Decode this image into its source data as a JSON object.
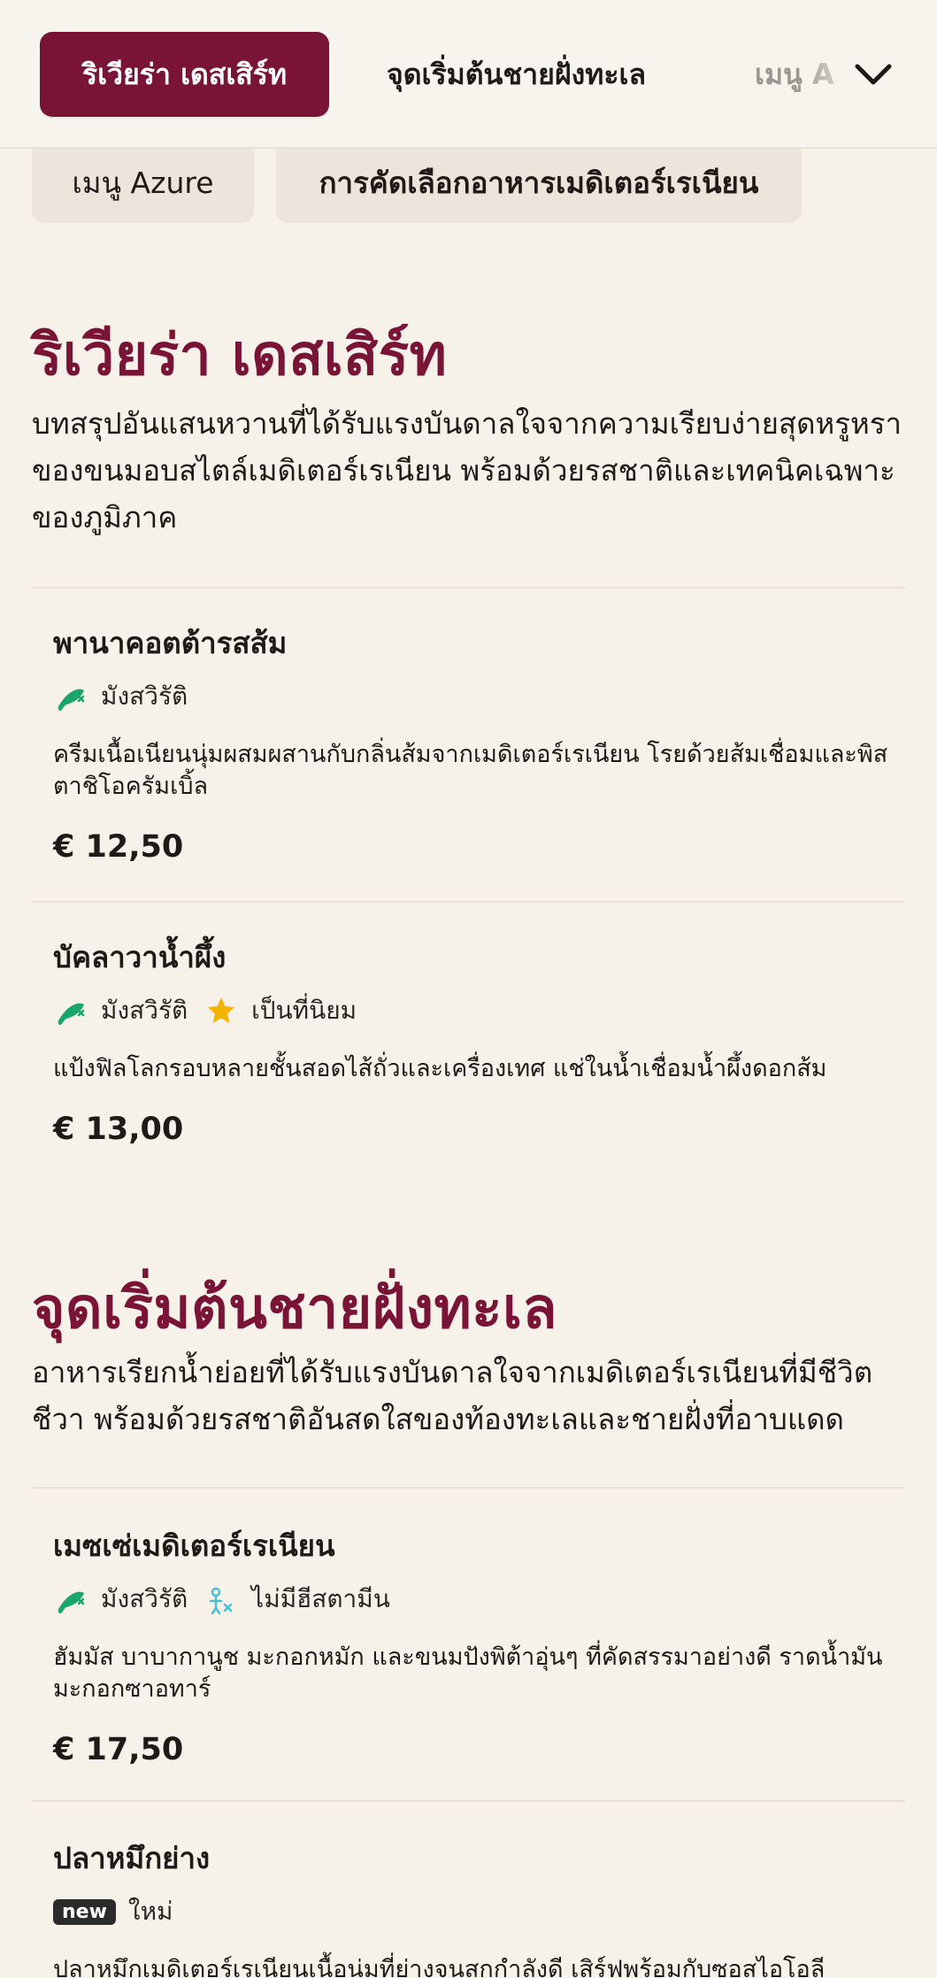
{
  "nav": {
    "tabs": [
      {
        "label": "ริเวียร่า เดสเสิร์ท",
        "active": true
      },
      {
        "label": "จุดเริ่มต้นชายฝั่งทะเล",
        "active": false
      },
      {
        "label": "เมนู Azure",
        "active": false
      }
    ],
    "more_icon": "chevron-down-icon",
    "pills": [
      {
        "label": "เมนู Azure"
      },
      {
        "label": "การคัดเลือกอาหารเมดิเตอร์เรเนียน"
      }
    ],
    "accent": "#7a1436"
  },
  "sections": [
    {
      "title": "ริเวียร่า เดสเสิร์ท",
      "description": "บทสรุปอันแสนหวานที่ได้รับแรงบันดาลใจจากความเรียบง่ายสุดหรูหราของขนมอบสไตล์เมดิเตอร์เรเนียน พร้อมด้วยรสชาติและเทคนิคเฉพาะของภูมิภาค",
      "items": [
        {
          "name": "พานาคอตต้ารสส้ม",
          "tags": [
            {
              "icon": "vegetarian-icon",
              "label": "มังสวิรัติ"
            }
          ],
          "description": "ครีมเนื้อเนียนนุ่มผสมผสานกับกลิ่นส้มจากเมดิเตอร์เรเนียน โรยด้วยส้มเชื่อมและพิสตาชิโอครัมเบิ้ล",
          "price": "€ 12,50"
        },
        {
          "name": "บัคลาวาน้ำผึ้ง",
          "tags": [
            {
              "icon": "vegetarian-icon",
              "label": "มังสวิรัติ"
            },
            {
              "icon": "star-icon",
              "label": "เป็นที่นิยม"
            }
          ],
          "description": "แป้งฟิลโลกรอบหลายชั้นสอดไส้ถั่วและเครื่องเทศ แช่ในน้ำเชื่อมน้ำผึ้งดอกส้ม",
          "price": "€ 13,00"
        }
      ]
    },
    {
      "title": "จุดเริ่มต้นชายฝั่งทะเล",
      "description": "อาหารเรียกน้ำย่อยที่ได้รับแรงบันดาลใจจากเมดิเตอร์เรเนียนที่มีชีวิตชีวา พร้อมด้วยรสชาติอันสดใสของท้องทะเลและชายฝั่งที่อาบแดด",
      "items": [
        {
          "name": "เมซเซ่เมดิเตอร์เรเนียน",
          "tags": [
            {
              "icon": "vegetarian-icon",
              "label": "มังสวิรัติ"
            },
            {
              "icon": "no-histamine-icon",
              "label": "ไม่มีฮีสตามีน"
            }
          ],
          "description": "ฮัมมัส บาบากานูช มะกอกหมัก และขนมปังพิต้าอุ่นๆ ที่คัดสรรมาอย่างดี ราดน้ำมันมะกอกซาอทาร์",
          "price": "€ 17,50"
        },
        {
          "name": "ปลาหมึกย่าง",
          "tags": [
            {
              "icon": "new-badge",
              "badge": "new",
              "label": "ใหม่"
            }
          ],
          "description": "ปลาหมึกเมดิเตอร์เรเนียนเนื้อนุ่มที่ย่างจนสุกกำลังดี เสิร์ฟพร้อมกับซอสไอโอลี"
        }
      ]
    }
  ],
  "colors": {
    "background": "#f6f2ea",
    "accent": "#7a1436",
    "vegetarian": "#1aa56b",
    "star": "#f3b300",
    "histamine": "#48c1d1"
  }
}
